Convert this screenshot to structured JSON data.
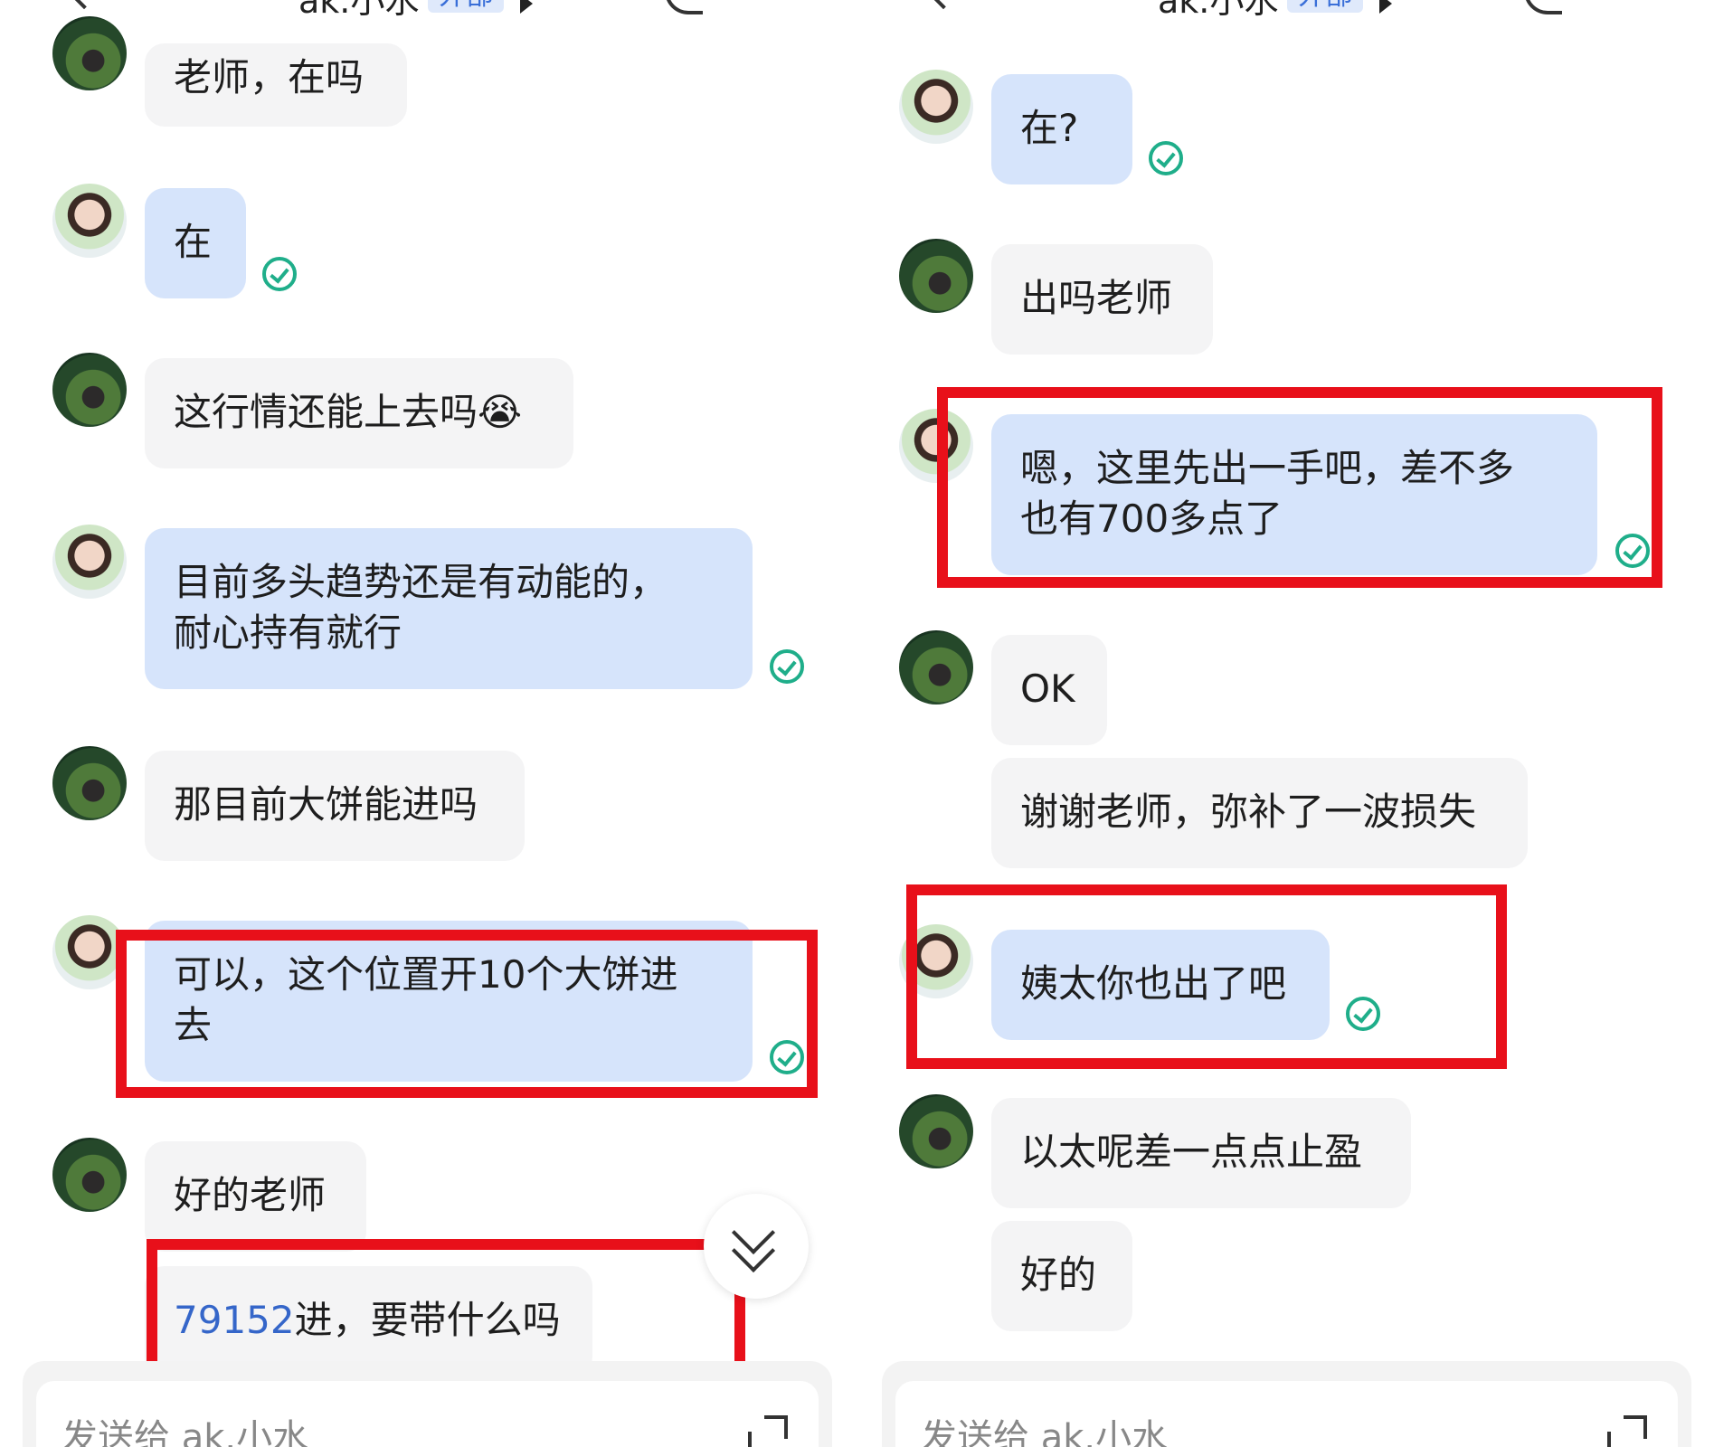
{
  "left": {
    "header": {
      "title": "ak.小水",
      "tag": "外部"
    },
    "messages": [
      {
        "text": "老师，在吗"
      },
      {
        "text": "在"
      },
      {
        "text": "这行情还能上去吗😭"
      },
      {
        "text": "目前多头趋势还是有动能的，\n耐心持有就行"
      },
      {
        "text": "那目前大饼能进吗"
      },
      {
        "text": "可以，这个位置开10个大饼进\n去"
      },
      {
        "text": "好的老师"
      },
      {
        "link": "79152",
        "text": "进，要带什么吗"
      }
    ],
    "input": {
      "placeholder": "发送给 ak.小水"
    }
  },
  "right": {
    "header": {
      "title": "ak.小水",
      "tag": "外部"
    },
    "messages": [
      {
        "text": "在?"
      },
      {
        "text": "出吗老师"
      },
      {
        "text": "嗯，这里先出一手吧，差不多\n也有700多点了"
      },
      {
        "text": "OK"
      },
      {
        "text": "谢谢老师，弥补了一波损失"
      },
      {
        "text": "姨太你也出了吧"
      },
      {
        "text": "以太呢差一点点止盈"
      },
      {
        "text": "好的"
      }
    ],
    "input": {
      "placeholder": "发送给 ak.小水"
    }
  },
  "colors": {
    "incoming_bubble": "#d6e4fb",
    "outgoing_bubble": "#f4f4f5",
    "highlight_box": "#e8101a",
    "read_check": "#1fae8a"
  }
}
